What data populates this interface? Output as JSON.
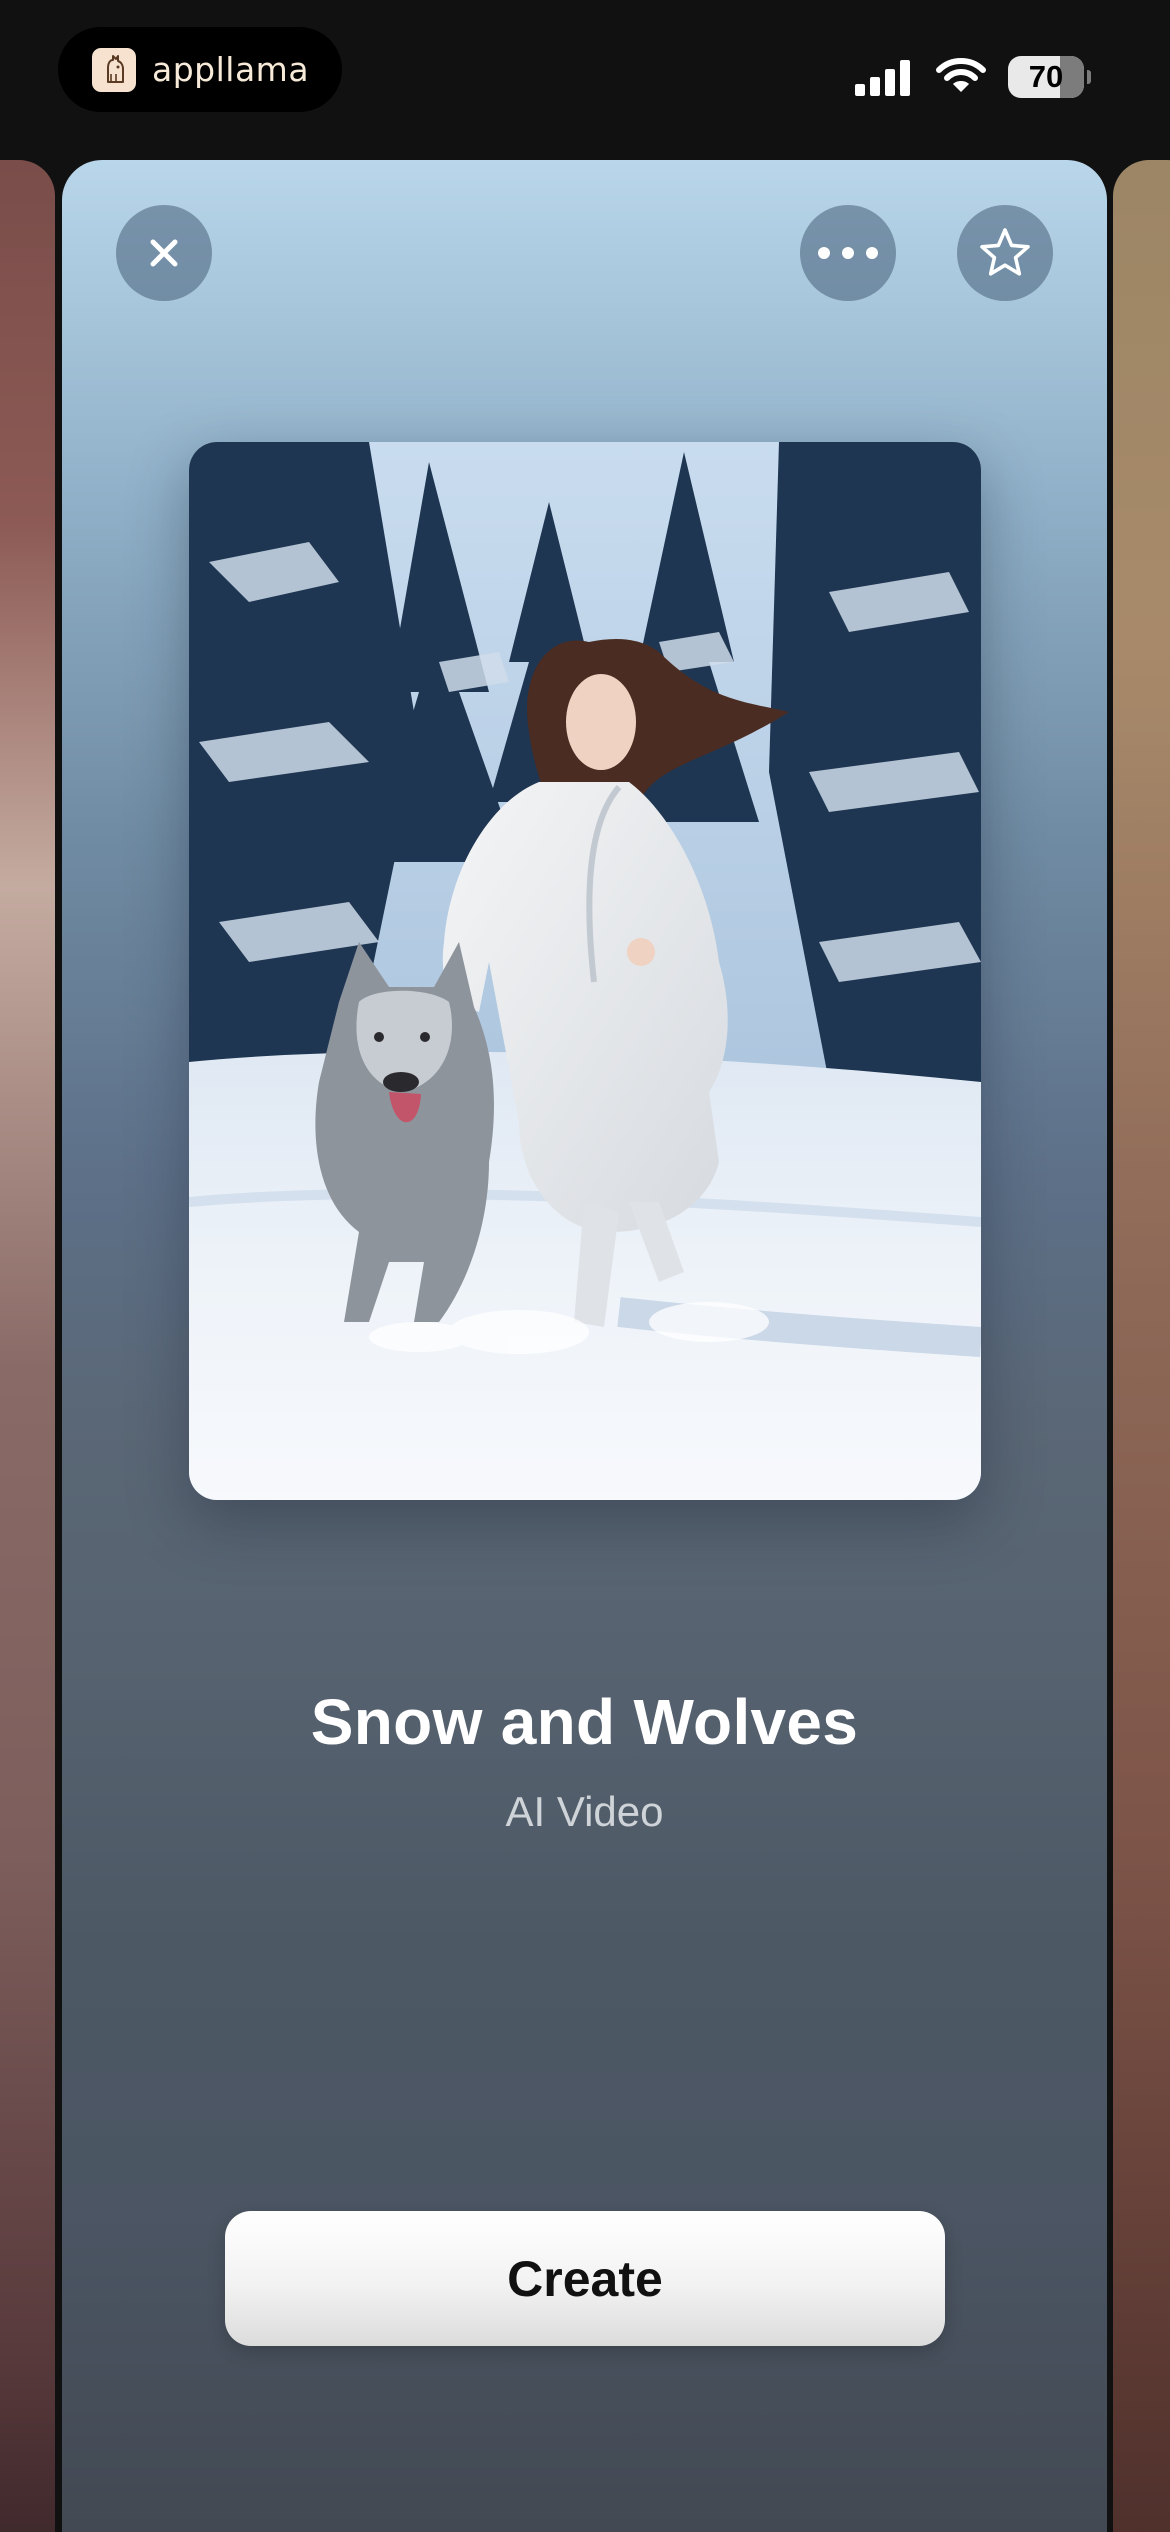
{
  "status_bar": {
    "brand_name": "appllama",
    "brand_icon": "llama-logo-icon",
    "battery_level": "70",
    "signal_icon": "cellular-signal-icon",
    "wifi_icon": "wifi-icon"
  },
  "card": {
    "title": "Snow and Wolves",
    "subtitle": "AI Video",
    "create_label": "Create",
    "close_icon": "close-icon",
    "more_icon": "more-horizontal-icon",
    "favorite_icon": "star-icon"
  },
  "colors": {
    "card_top": "#b9d6ea",
    "card_bottom": "#414750",
    "button_bg": "#ffffff",
    "button_text": "#111111"
  }
}
